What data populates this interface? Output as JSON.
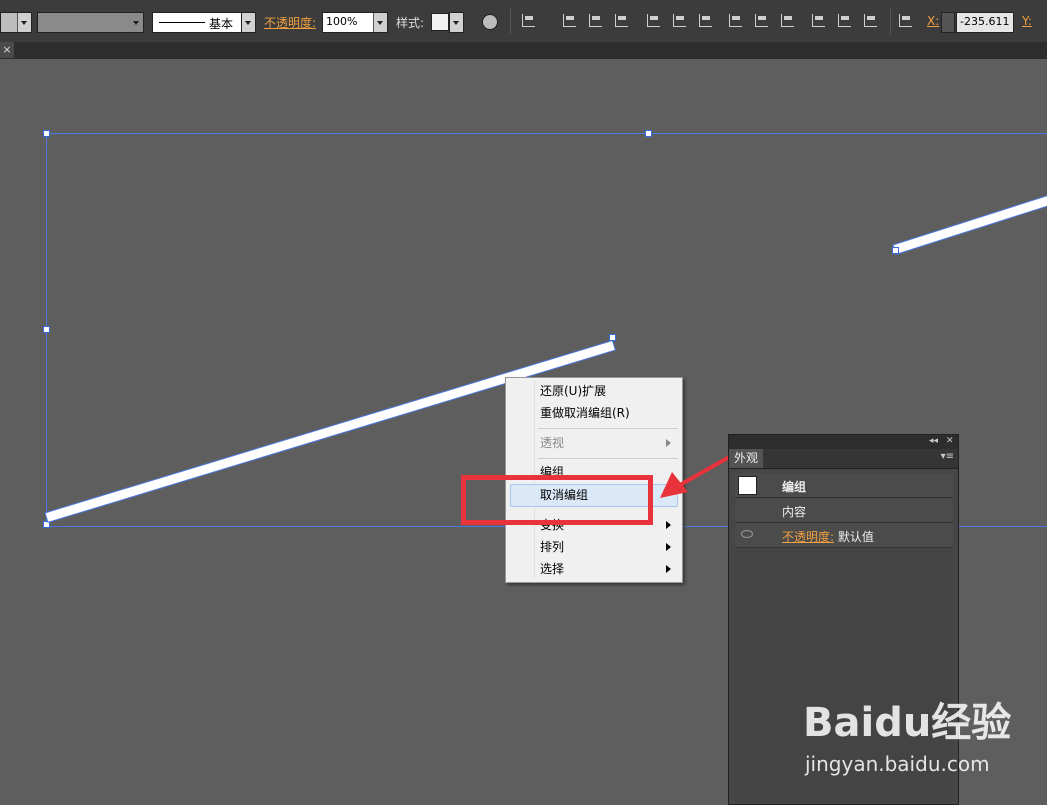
{
  "control_bar": {
    "stroke_style": "基本",
    "opacity_label": "不透明度:",
    "opacity_value": "100%",
    "style_label": "样式:",
    "x_label": "X:",
    "x_value": "-235.611",
    "y_label": "Y:"
  },
  "tab": {
    "close_glyph": "×"
  },
  "context_menu": {
    "items": [
      {
        "label": "还原(U)扩展",
        "enabled": true
      },
      {
        "label": "重做取消编组(R)",
        "enabled": true
      },
      {
        "label": "透视",
        "enabled": false,
        "submenu": true
      },
      {
        "label": "编组",
        "enabled": true
      },
      {
        "label": "取消编组",
        "enabled": true,
        "highlighted": true
      },
      {
        "label": "变换",
        "enabled": true,
        "submenu": true
      },
      {
        "label": "排列",
        "enabled": true,
        "submenu": true
      },
      {
        "label": "选择",
        "enabled": true,
        "submenu": true
      }
    ]
  },
  "appearance_panel": {
    "tab_label": "外观",
    "collapse_glyph": "◂◂",
    "close_glyph": "✕",
    "menu_glyph": "▾≡",
    "group_label": "编组",
    "contents_label": "内容",
    "opacity_label": "不透明度:",
    "opacity_value": "默认值"
  },
  "watermark": {
    "logo": "Baidu经验",
    "url": "jingyan.baidu.com"
  },
  "colors": {
    "selection": "#4a78e0",
    "annotation_red": "#e8323c",
    "accent_orange": "#f0a040"
  }
}
